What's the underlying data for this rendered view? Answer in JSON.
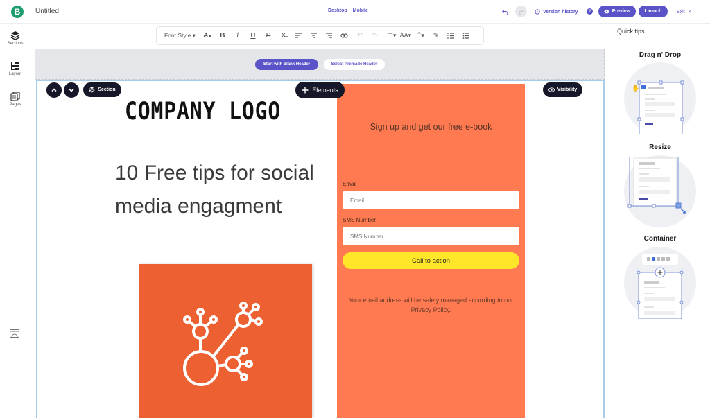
{
  "app": {
    "logo_letter": "B",
    "doc_title": "Untitled",
    "brand_color": "#5b54c8",
    "device_tabs": [
      "Desktop",
      "Mobile"
    ],
    "version_history_label": "Version history",
    "help_label": "?",
    "preview_label": "Preview",
    "launch_label": "Launch",
    "exit_label": "Exit",
    "exit_icon": "×"
  },
  "sidebar": {
    "items": [
      {
        "label": "Sections",
        "icon": "layers-icon"
      },
      {
        "label": "Layout",
        "icon": "layout-icon"
      },
      {
        "label": "Pages",
        "icon": "pages-icon"
      }
    ],
    "bottom_icon": "image-icon"
  },
  "toolbar": {
    "font_style_label": "Font Style ▾",
    "tools": [
      "text-color",
      "bold",
      "italic",
      "underline",
      "strikethrough",
      "clear-format",
      "align-left",
      "align-center",
      "align-right",
      "link",
      "undo",
      "redo",
      "line-height",
      "font-size",
      "text-spacing",
      "highlight",
      "ordered-list",
      "unordered-list"
    ]
  },
  "canvas": {
    "header_zone": {
      "blank_header_label": "Start with Blank Header",
      "premade_header_label": "Select Premade Header"
    },
    "section_label": "Section",
    "elements_label": "Elements",
    "visibility_label": "Visibility",
    "company_logo_text": "COMPANY LOGO",
    "headline": "10 Free tips for social media engagment",
    "form": {
      "title": "Sign up and get our free e-book",
      "email_label": "Email",
      "email_placeholder": "Email",
      "sms_label": "SMS Number",
      "sms_placeholder": "SMS Number",
      "cta_label": "Call to action",
      "note": "Your email address will be safely managed according to our Privacy Policy.",
      "bg_color": "#ff7a50",
      "cta_color": "#ffe629"
    },
    "hero_color": "#ec6032"
  },
  "quick_tips": {
    "title": "Quick tips",
    "tips": [
      {
        "heading": "Drag n' Drop"
      },
      {
        "heading": "Resize"
      },
      {
        "heading": "Container"
      }
    ]
  }
}
